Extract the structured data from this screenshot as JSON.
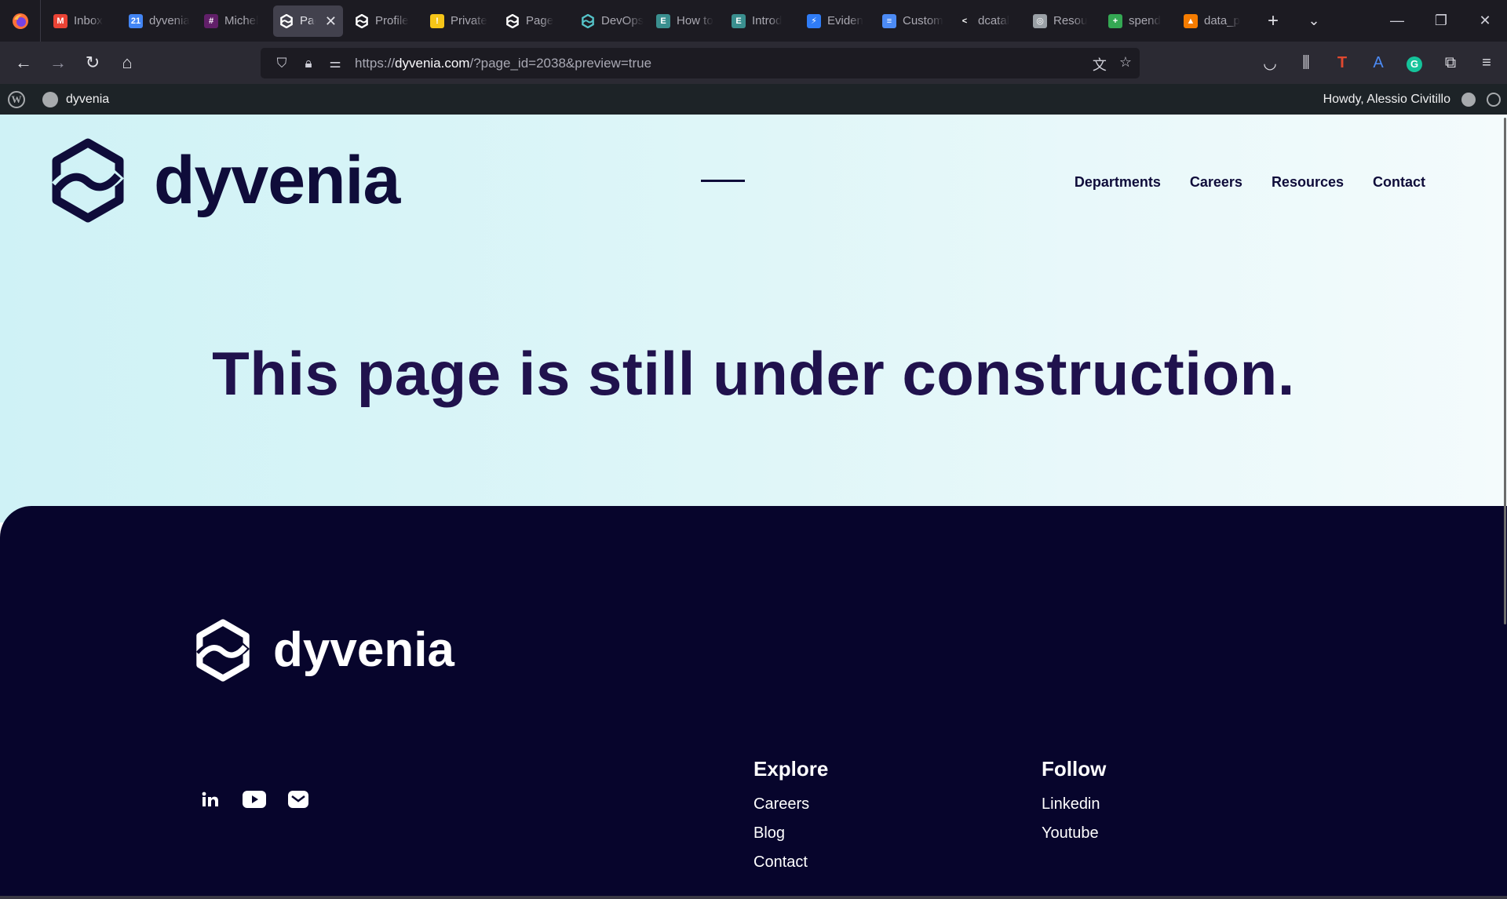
{
  "browser": {
    "tabs": [
      {
        "label": "Inbox",
        "icon": "gmail-icon",
        "color": "#ea4335",
        "glyph": "M"
      },
      {
        "label": "dyvenia",
        "icon": "calendar-icon",
        "color": "#4285f4",
        "glyph": "21"
      },
      {
        "label": "Michel",
        "icon": "slack-icon",
        "color": "#611f69",
        "glyph": "#"
      },
      {
        "label": "Page",
        "icon": "dyvenia-icon",
        "color": "#ffffff",
        "glyph": "",
        "active": true
      },
      {
        "label": "Profile",
        "icon": "dyvenia-icon",
        "color": "#ffffff",
        "glyph": ""
      },
      {
        "label": "Private",
        "icon": "shield-icon",
        "color": "#f5c518",
        "glyph": "!"
      },
      {
        "label": "Page",
        "icon": "dyvenia-icon",
        "color": "#ffffff",
        "glyph": ""
      },
      {
        "label": "DevOps",
        "icon": "dyvenia-icon",
        "color": "#55c3c8",
        "glyph": ""
      },
      {
        "label": "How to",
        "icon": "e-icon",
        "color": "#3a8f8f",
        "glyph": "E"
      },
      {
        "label": "Introd",
        "icon": "e-icon",
        "color": "#3a8f8f",
        "glyph": "E"
      },
      {
        "label": "Eviden",
        "icon": "bolt-icon",
        "color": "#2f7cf6",
        "glyph": "⚡"
      },
      {
        "label": "Custom",
        "icon": "docs-icon",
        "color": "#4c8bf5",
        "glyph": "≡"
      },
      {
        "label": "dcatal",
        "icon": "chevron-icon",
        "color": "#1c1b22",
        "glyph": "<"
      },
      {
        "label": "Resou",
        "icon": "openai-icon",
        "color": "#9aa0a6",
        "glyph": "◎"
      },
      {
        "label": "spend",
        "icon": "sheets-icon",
        "color": "#34a853",
        "glyph": "+"
      },
      {
        "label": "data_p",
        "icon": "chart-icon",
        "color": "#f57c00",
        "glyph": "▲"
      }
    ],
    "url": {
      "scheme": "https://",
      "host": "dyvenia.com",
      "rest": "/?page_id=2038&preview=true"
    }
  },
  "wpbar": {
    "site_name": "dyvenia",
    "greeting": "Howdy, Alessio Civitillo"
  },
  "site": {
    "brand": "dyvenia",
    "nav": [
      "Departments",
      "Careers",
      "Resources",
      "Contact"
    ],
    "headline": "This page is still under construction.",
    "footer": {
      "brand": "dyvenia",
      "explore": {
        "title": "Explore",
        "links": [
          "Careers",
          "Blog",
          "Contact"
        ]
      },
      "follow": {
        "title": "Follow",
        "links": [
          "Linkedin",
          "Youtube"
        ]
      }
    }
  },
  "colors": {
    "navy": "#0f0c3a",
    "headline": "#20124d",
    "footer_bg": "#07052c",
    "hero_start": "#cff2f6"
  }
}
